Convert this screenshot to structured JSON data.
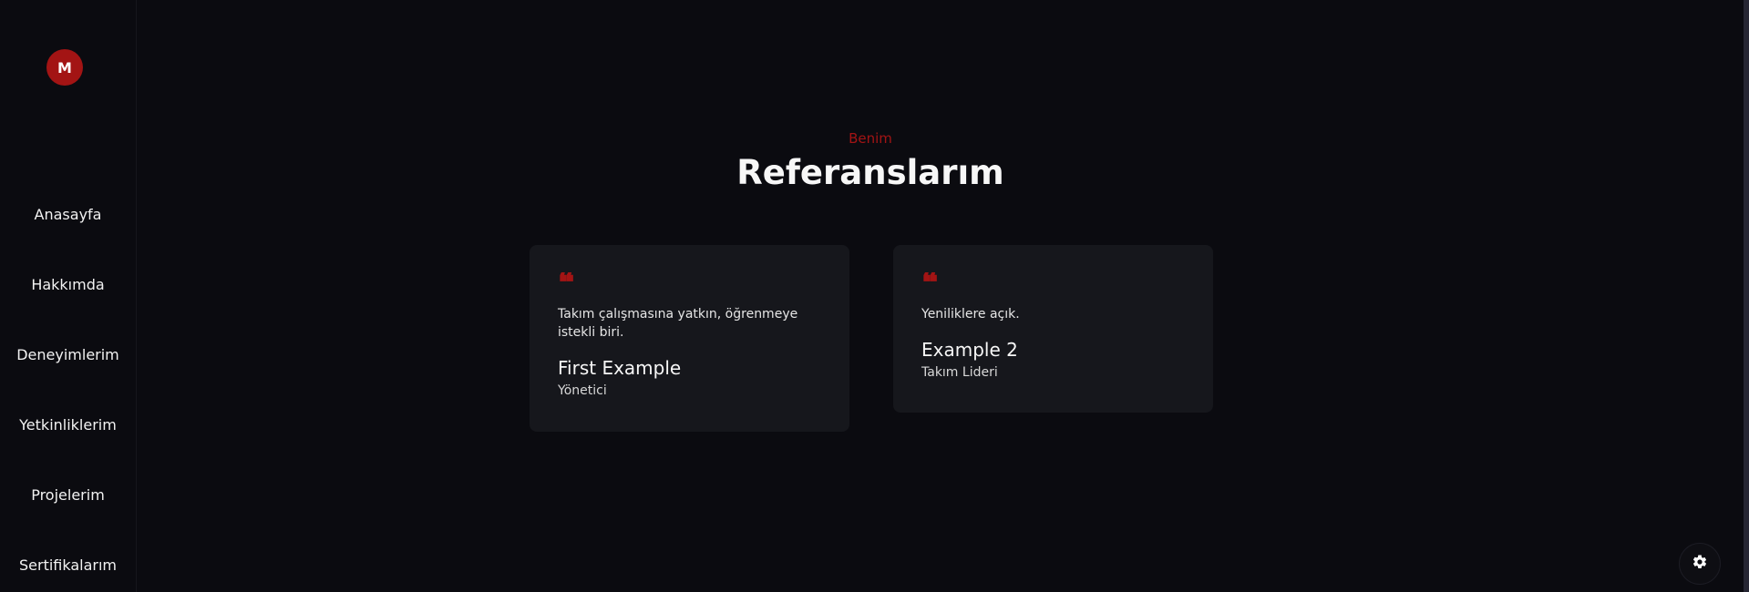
{
  "sidebar": {
    "avatar_letter": "M",
    "items": [
      {
        "label": "Anasayfa"
      },
      {
        "label": "Hakkımda"
      },
      {
        "label": "Deneyimlerim"
      },
      {
        "label": "Yetkinliklerim"
      },
      {
        "label": "Projelerim"
      },
      {
        "label": "Sertifikalarım"
      }
    ]
  },
  "section": {
    "eyebrow": "Benim",
    "title": "Referanslarım"
  },
  "references": [
    {
      "quote_mark": "❝",
      "text": "Takım çalışmasına yatkın, öğrenmeye istekli biri.",
      "name": "First Example",
      "role": "Yönetici"
    },
    {
      "quote_mark": "❝",
      "text": "Yeniliklere açık.",
      "name": "Example 2",
      "role": "Takım Lideri"
    }
  ],
  "settings": {
    "icon": "gear-icon"
  },
  "colors": {
    "background": "#0b0b10",
    "card": "#16171c",
    "accent": "#a31414",
    "text": "#f2f2f2"
  }
}
